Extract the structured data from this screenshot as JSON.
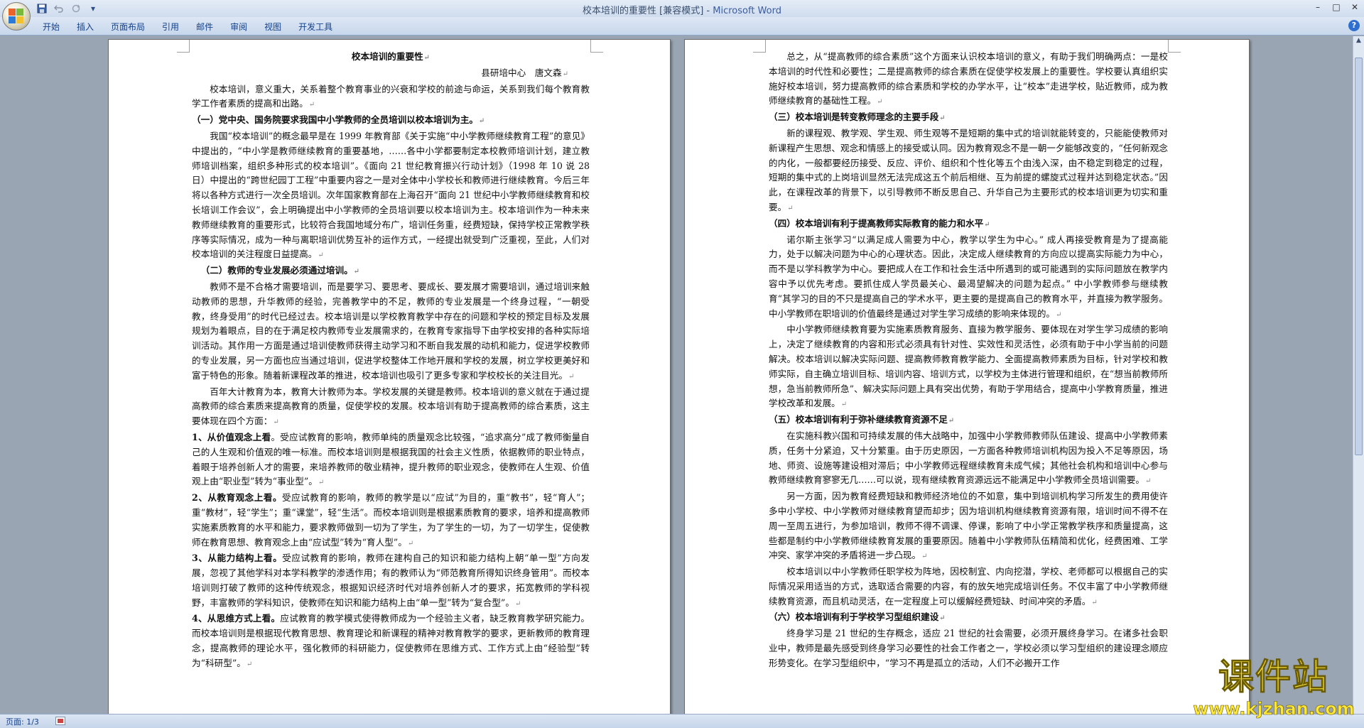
{
  "window": {
    "title": "校本培训的重要性 [兼容模式] - ",
    "app_name": "Microsoft Word"
  },
  "qat": {
    "save_icon": "save-icon",
    "undo_icon": "undo-icon",
    "redo_icon": "redo-icon",
    "customize": "▾"
  },
  "ribbon": {
    "tabs": [
      "开始",
      "插入",
      "页面布局",
      "引用",
      "邮件",
      "审阅",
      "视图",
      "开发工具"
    ]
  },
  "status": {
    "page_count": "页面: 1/3"
  },
  "watermark": {
    "main": "课件站",
    "url": "www.kjzhan.com"
  },
  "page1": {
    "title": "校本培训的重要性",
    "author": "县研培中心　唐文森",
    "p_intro": "校本培训，意义重大，关系着整个教育事业的兴衰和学校的前途与命运，关系到我们每个教育教学工作者素质的提高和出路。",
    "h1": "（一）党中央、国务院要求我国中小学教师的全员培训以校本培训为主。",
    "p1": "我国“校本培训”的概念最早是在 1999 年教育部《关于实施“中小学教师继续教育工程”的意见》中提出的，“中小学是教师继续教育的重要基地，……各中小学都要制定本校教师培训计划，建立教师培训档案，组织多种形式的校本培训”。《面向 21 世纪教育振兴行动计划》（1998 年 10 说 28 日）中提出的“跨世纪园丁工程”中重要内容之一是对全体中小学校长和教师进行继续教育。今后三年将以各种方式进行一次全员培训。次年国家教育部在上海召开“面向 21 世纪中小学教师继续教育和校长培训工作会议”，会上明确提出中小学教师的全员培训要以校本培训为主。校本培训作为一种未来教师继续教育的重要形式，比较符合我国地域分布广，培训任务重，经费短缺，保持学校正常教学秩序等实际情况，成为一种与离职培训优势互补的运作方式，一经提出就受到广泛重视，至此，人们对校本培训的关注程度日益提高。",
    "h2": "（二）教师的专业发展必须通过培训。",
    "p2": "教师不是不合格才需要培训，而是要学习、要思考、要成长、要发展才需要培训，通过培训来触动教师的思想，升华教师的经验，完善教学中的不足，教师的专业发展是一个终身过程，“一朝受教，终身受用”的时代已经过去。校本培训是以学校教育教学中存在的问题和学校的预定目标及发展规划为着眼点，目的在于满足校内教师专业发展需求的，在教育专家指导下由学校安排的各种实际培训活动。其作用一方面是通过培训使教师获得主动学习和不断自我发展的动机和能力，促进学校教师的专业发展，另一方面也应当通过培训，促进学校整体工作地开展和学校的发展，树立学校更美好和富于特色的形象。随着新课程改革的推进，校本培训也吸引了更多专家和学校校长的关注目光。",
    "p3": "百年大计教育为本，教育大计教师为本。学校发展的关键是教师。校本培训的意义就在于通过提高教师的综合素质来提高教育的质量，促使学校的发展。校本培训有助于提高教师的综合素质，这主要体现在四个方面：",
    "s1_title": "1、从价值观念上看",
    "s1": "。受应试教育的影响，教师单纯的质量观念比较强，“追求高分”成了教师衡量自己的人生观和价值观的唯一标准。而校本培训则是根据我国的社会主义性质，依据教师的职业特点，着眼于培养创新人才的需要，来培养教师的敬业精神，提升教师的职业观念，使教师在人生观、价值观上由“职业型”转为“事业型”。",
    "s2_title": "2、从教育观念上看。",
    "s2": "受应试教育的影响，教师的教学是以“应试”为目的，重“教书”，轻“育人”；重“教材”，轻“学生”；重“课堂”，轻“生活”。而校本培训则是根据素质教育的要求，培养和提高教师实施素质教育的水平和能力，要求教师做到一切为了学生，为了学生的一切，为了一切学生，促使教师在教育思想、教育观念上由“应试型”转为“育人型”。",
    "s3_title": "3、从能力结构上看。",
    "s3": "受应试教育的影响，教师在建构自己的知识和能力结构上朝“单一型”方向发展，忽视了其他学科对本学科教学的渗透作用；有的教师认为“师范教育所得知识终身管用”。而校本培训则打破了教师的这种传统观念，根据知识经济时代对培养创新人才的要求，拓宽教师的学科视野，丰富教师的学科知识，使教师在知识和能力结构上由“单一型”转为“复合型”。",
    "s4_title": "4、从思维方式上看。",
    "s4": "应试教育的教学模式使得教师成为一个经验主义者，缺乏教育教学研究能力。而校本培训则是根据现代教育思想、教育理论和新课程的精神对教育教学的要求，更新教师的教育理念，提高教师的理论水平，强化教师的科研能力，促使教师在思维方式、工作方式上由“经验型”转为“科研型”。"
  },
  "page2": {
    "p0": "总之，从“提高教师的综合素质”这个方面来认识校本培训的意义，有助于我们明确两点：一是校本培训的时代性和必要性；二是提高教师的综合素质在促使学校发展上的重要性。学校要认真组织实施好校本培训，努力提高教师的综合素质和学校的办学水平，让“校本”走进学校，贴近教师，成为教师继续教育的基础性工程。",
    "h3": "（三）校本培训是转变教师理念的主要手段",
    "p1": "新的课程观、教学观、学生观、师生观等不是短期的集中式的培训就能转变的，只能能使教师对新课程产生思想、观念和情感上的接受或认同。因为教育观念不是一朝一夕能够改变的，“任何新观念的内化，一般都要经历接受、反应、评价、组织和个性化等五个由浅入深，由不稳定到稳定的过程，短期的集中式的上岗培训显然无法完成这五个前后相继、互为前提的螺旋式过程并达到稳定状态。”因此，在课程改革的背景下，以引导教师不断反思自己、升华自己为主要形式的校本培训更为切实和重要。",
    "h4": "（四）校本培训有利于提高教师实际教育的能力和水平",
    "p2": "诺尔斯主张学习“以满足成人需要为中心，教学以学生为中心。” 成人再接受教育是为了提高能力，处于以解决问题为中心的心理状态。因此，决定成人继续教育的方向应以提高实际能力为中心，而不是以学科教学为中心。要把成人在工作和社会生活中所遇到的或可能遇到的实际问题放在教学内容中予以优先考虑。要抓住成人学员最关心、最渴望解决的问题为起点。” 中小学教师参与继续教育“其学习的目的不只是提高自己的学术水平，更主要的是提高自己的教育水平，并直接为教学服务。中小学教师在职培训的价值最终是通过对学生学习成绩的影响来体现的。",
    "p3": "中小学教师继续教育要为实施素质教育服务、直接为教学服务、要体现在对学生学习成绩的影响上，决定了继续教育的内容和形式必须具有针对性、实效性和灵活性，必须有助于中小学当前的问题解决。校本培训以解决实际问题、提高教师教育教学能力、全面提高教师素质为目标，针对学校和教师实际，自主确立培训目标、培训内容、培训方式，以学校为主体进行管理和组织，在“想当前教师所想，急当前教师所急”、解决实际问题上具有突出优势，有助于学用结合，提高中小学教育质量，推进学校改革和发展。",
    "h5": "（五）校本培训有利于弥补继续教育资源不足",
    "p4": "在实施科教兴国和可持续发展的伟大战略中，加强中小学教师教师队伍建设、提高中小学教师素质，任务十分紧迫，又十分繁重。由于历史原因，一方面各种教师培训机构因为投入不足等原因，场地、师资、设施等建设相对滞后；中小学教师远程继续教育未成气候；其他社会机构和培训中心参与教师继续教育寥寥无几……可以说，现有继续教育资源远远不能满足中小学教师全员培训需要。",
    "p5": "另一方面，因为教育经费短缺和教师经济地位的不如意，集中到培训机构学习所发生的费用使许多中小学校、中小学教师对继续教育望而却步；因为培训机构继续教育资源有限，培训时间不得不在周一至周五进行，为参加培训，教师不得不调课、停课，影响了中小学正常教学秩序和质量提高，这些都是制约中小学教师继续教育发展的重要原因。随着中小学教师队伍精简和优化，经费困难、工学冲突、家学冲突的矛盾将进一步凸现。",
    "p6": "校本培训以中小学教师任职学校为阵地，因校制宜、内向挖潜，学校、老师都可以根据自己的实际情况采用适当的方式，选取适合需要的内容，有的放矢地完成培训任务。不仅丰富了中小学教师继续教育资源，而且机动灵活，在一定程度上可以缓解经费短缺、时间冲突的矛盾。",
    "h6": "（六）校本培训有利于学校学习型组织建设",
    "p7": "终身学习是 21 世纪的生存概念，适应 21 世纪的社会需要，必须开展终身学习。在诸多社会职业中，教师是最先感受到终身学习必要性的社会工作者之一，学校必须以学习型组织的建设理念顺应形势变化。在学习型组织中，“学习不再是孤立的活动，人们不必搬开工作"
  }
}
